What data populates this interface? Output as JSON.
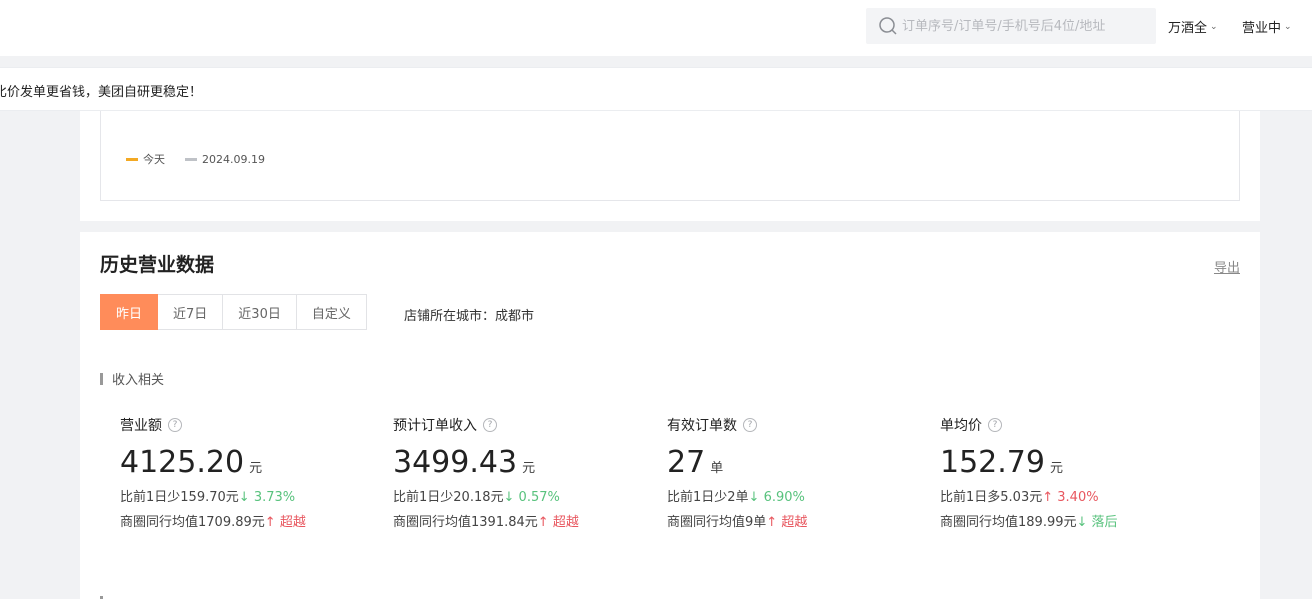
{
  "topbar": {
    "search_placeholder": "订单序号/订单号/手机号后4位/地址",
    "store_name": "万酒全",
    "status": "营业中"
  },
  "notice": {
    "text": "比价发单更省钱，美团自研更稳定！"
  },
  "chart_legend": [
    {
      "label": "今天",
      "color": "#f3a923"
    },
    {
      "label": "2024.09.19",
      "color": "#bfc2c7"
    }
  ],
  "history": {
    "title": "历史营业数据",
    "export_label": "导出",
    "tabs": [
      "昨日",
      "近7日",
      "近30日",
      "自定义"
    ],
    "active_tab": "昨日",
    "city": "店铺所在城市：成都市",
    "section_label": "收入相关",
    "metrics": [
      {
        "name": "营业额",
        "value": "4125.20",
        "unit": "元",
        "compare_text": "比前1日少159.70元",
        "compare_arrow": "↓",
        "compare_pct": "3.73%",
        "compare_color": "green",
        "peer_text": "商圈同行均值1709.89元",
        "peer_arrow": "↑",
        "peer_label": "超越",
        "peer_color": "red"
      },
      {
        "name": "预计订单收入",
        "value": "3499.43",
        "unit": "元",
        "compare_text": "比前1日少20.18元",
        "compare_arrow": "↓",
        "compare_pct": "0.57%",
        "compare_color": "green",
        "peer_text": "商圈同行均值1391.84元",
        "peer_arrow": "↑",
        "peer_label": "超越",
        "peer_color": "red"
      },
      {
        "name": "有效订单数",
        "value": "27",
        "unit": "单",
        "compare_text": "比前1日少2单",
        "compare_arrow": "↓",
        "compare_pct": "6.90%",
        "compare_color": "green",
        "peer_text": "商圈同行均值9单",
        "peer_arrow": "↑",
        "peer_label": "超越",
        "peer_color": "red"
      },
      {
        "name": "单均价",
        "value": "152.79",
        "unit": "元",
        "compare_text": "比前1日多5.03元",
        "compare_arrow": "↑",
        "compare_pct": "3.40%",
        "compare_color": "red",
        "peer_text": "商圈同行均值189.99元",
        "peer_arrow": "↓",
        "peer_label": "落后",
        "peer_color": "green"
      }
    ]
  }
}
